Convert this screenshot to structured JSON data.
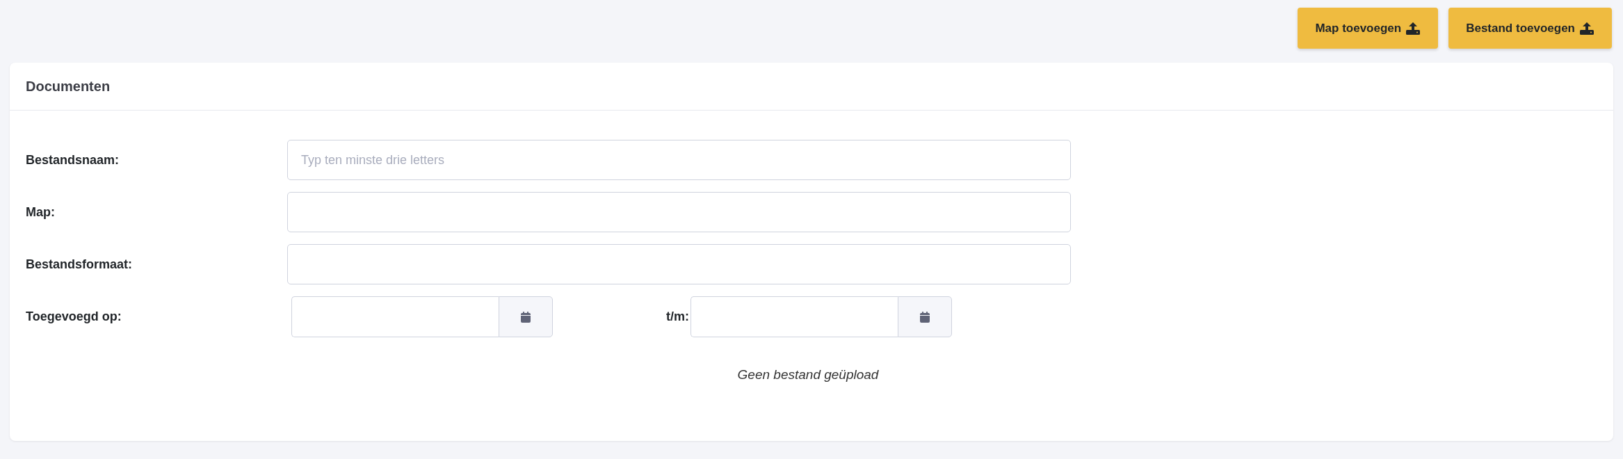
{
  "toolbar": {
    "buttons": [
      {
        "label": "Map toevoegen"
      },
      {
        "label": "Bestand toevoegen"
      }
    ]
  },
  "card": {
    "title": "Documenten",
    "fields": [
      {
        "kind": "text",
        "label": "Bestandsnaam:",
        "placeholder": "Typ ten minste drie letters"
      },
      {
        "kind": "text",
        "label": "Map:"
      },
      {
        "kind": "text",
        "label": "Bestandsformaat:"
      },
      {
        "kind": "daterange",
        "label": "Toegevoegd op:",
        "separator": "t/m:"
      }
    ],
    "empty_message": "Geen bestand geüpload"
  }
}
